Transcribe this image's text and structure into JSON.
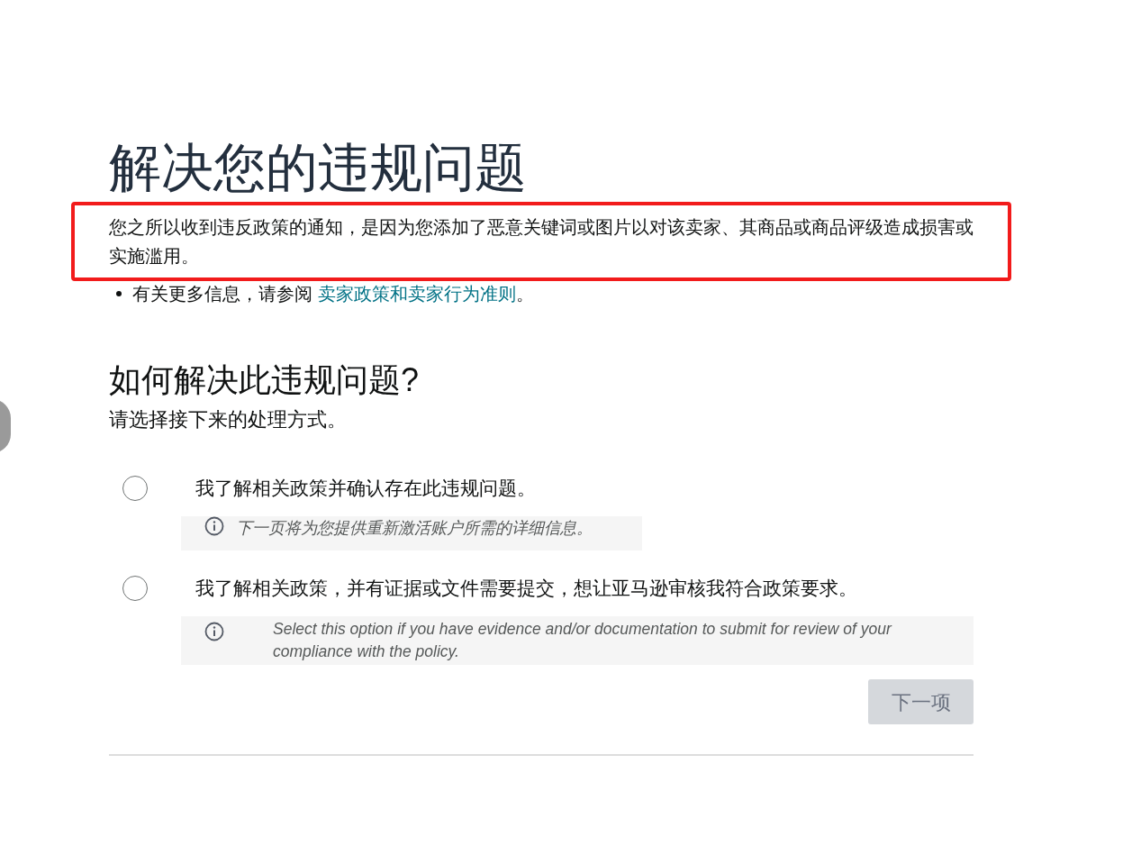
{
  "title": "解决您的违规问题",
  "notice": {
    "text": "您之所以收到违反政策的通知，是因为您添加了恶意关键词或图片以对该卖家、其商品或商品评级造成损害或实施滥用。",
    "highlighted": true
  },
  "more_info": {
    "prefix": "有关更多信息，请参阅 ",
    "link": "卖家政策和卖家行为准则",
    "suffix": "。"
  },
  "section_heading": "如何解决此违规问题?",
  "prompt": "请选择接下来的处理方式。",
  "options": [
    {
      "label": "我了解相关政策并确认存在此违规问题。",
      "selected": false,
      "note": "下一页将为您提供重新激活账户所需的详细信息。",
      "kind": "compact"
    },
    {
      "label": "我了解相关政策，并有证据或文件需要提交，想让亚马逊审核我符合政策要求。",
      "selected": false,
      "note": "Select this option if you have evidence and/or documentation to submit for review of your compliance with the policy.",
      "kind": "wide"
    }
  ],
  "next_button": {
    "label": "下一项",
    "disabled": true
  }
}
